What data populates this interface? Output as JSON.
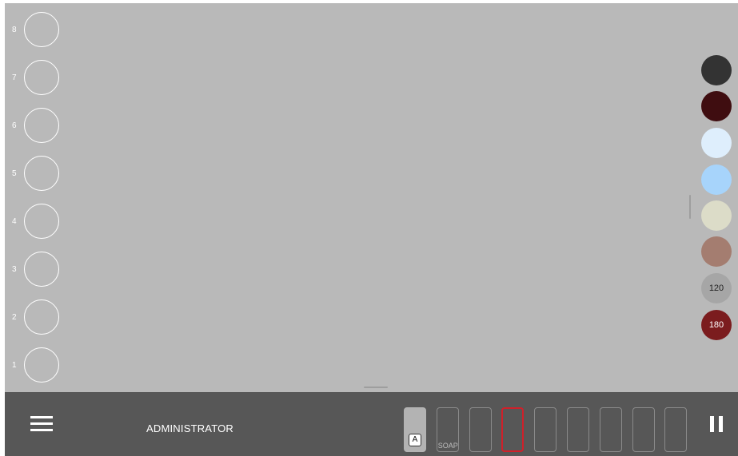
{
  "slots": [
    {
      "label": "8"
    },
    {
      "label": "7"
    },
    {
      "label": "6"
    },
    {
      "label": "5"
    },
    {
      "label": "4"
    },
    {
      "label": "3"
    },
    {
      "label": "2"
    },
    {
      "label": "1"
    }
  ],
  "swatches": [
    {
      "color": "#333333",
      "label": ""
    },
    {
      "color": "#3f0d10",
      "label": ""
    },
    {
      "color": "#deeefc",
      "label": ""
    },
    {
      "color": "#a7d4fb",
      "label": ""
    },
    {
      "color": "#dcdcc8",
      "label": ""
    },
    {
      "color": "#a47d70",
      "label": ""
    },
    {
      "color": "#a6a6a6",
      "label": "120"
    },
    {
      "color": "#7b1c1e",
      "label": "180"
    }
  ],
  "toolbar": {
    "user": "ADMINISTRATOR",
    "slots": [
      {
        "badge": "A",
        "text": ""
      },
      {
        "badge": "",
        "text": "SOAP"
      },
      {
        "badge": "",
        "text": ""
      },
      {
        "badge": "",
        "text": ""
      },
      {
        "badge": "",
        "text": ""
      },
      {
        "badge": "",
        "text": ""
      },
      {
        "badge": "",
        "text": ""
      },
      {
        "badge": "",
        "text": ""
      },
      {
        "badge": "",
        "text": ""
      }
    ],
    "active_index": 3
  },
  "icons": {
    "menu": "hamburger-menu-icon",
    "pause": "pause-icon"
  }
}
